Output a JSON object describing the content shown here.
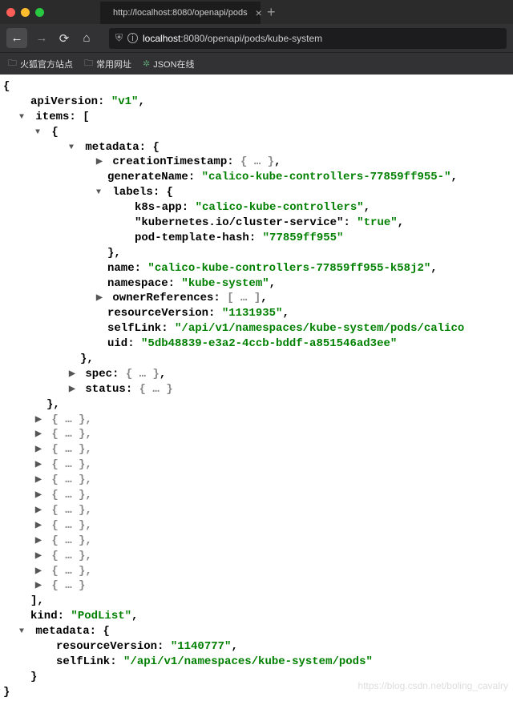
{
  "tab": {
    "title": "http://localhost:8080/openapi/pods"
  },
  "address": {
    "host": "localhost",
    "rest": ":8080/openapi/pods/kube-system"
  },
  "bookmarks": [
    {
      "icon": "folder",
      "label": "火狐官方站点"
    },
    {
      "icon": "folder",
      "label": "常用网址"
    },
    {
      "icon": "gear",
      "label": "JSON在线"
    }
  ],
  "json": {
    "apiVersion_key": "apiVersion:",
    "apiVersion_val": "\"v1\"",
    "items_key": "items:",
    "items_open": "[",
    "brace_open": "{",
    "metadata_key": "metadata:",
    "creationTimestamp_key": "creationTimestamp:",
    "collapsed_obj": "{ … }",
    "generateName_key": "generateName:",
    "generateName_val": "\"calico-kube-controllers-77859ff955-\"",
    "labels_key": "labels:",
    "k8s_app_key": "k8s-app:",
    "k8s_app_val": "\"calico-kube-controllers\"",
    "cluster_service_key": "\"kubernetes.io/cluster-service\":",
    "cluster_service_val": "\"true\"",
    "pod_template_hash_key": "pod-template-hash:",
    "pod_template_hash_val": "\"77859ff955\"",
    "brace_close_comma": "},",
    "name_key": "name:",
    "name_val": "\"calico-kube-controllers-77859ff955-k58j2\"",
    "namespace_key": "namespace:",
    "namespace_val": "\"kube-system\"",
    "ownerReferences_key": "ownerReferences:",
    "collapsed_arr": "[ … ]",
    "resourceVersion_key": "resourceVersion:",
    "resourceVersion_val": "\"1131935\"",
    "selfLink_key": "selfLink:",
    "selfLink_val": "\"/api/v1/namespaces/kube-system/pods/calico",
    "uid_key": "uid:",
    "uid_val": "\"5db48839-e3a2-4ccb-bddf-a851546ad3ee\"",
    "spec_key": "spec:",
    "status_key": "status:",
    "collapsed_obj_nc": "{ … }",
    "collapsed_item": "{ … },",
    "collapsed_item_last": "{ … }",
    "items_close": "],",
    "kind_key": "kind:",
    "kind_val": "\"PodList\"",
    "metadata2_key": "metadata:",
    "resourceVersion2_val": "\"1140777\"",
    "selfLink2_val": "\"/api/v1/namespaces/kube-system/pods\"",
    "brace_close": "}"
  },
  "watermark": "https://blog.csdn.net/boling_cavalry"
}
